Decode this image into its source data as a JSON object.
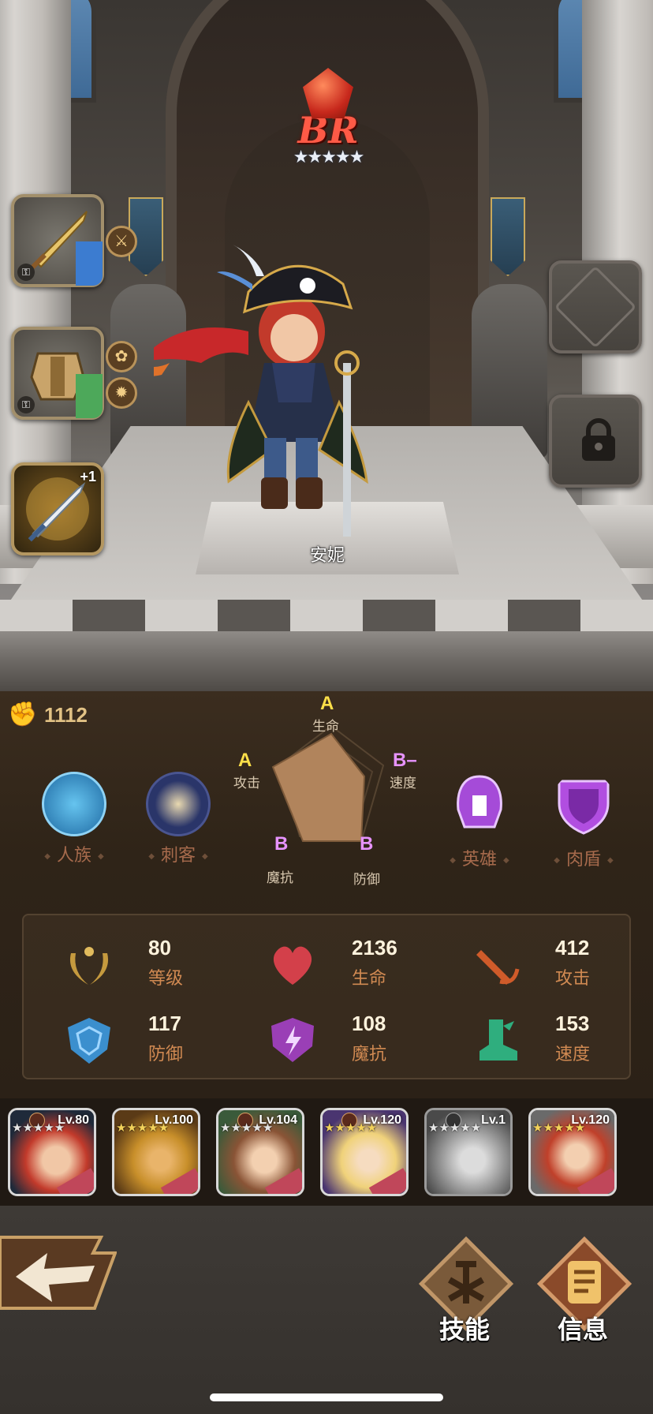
{
  "hero": {
    "name": "安妮",
    "rank": "BR",
    "stars": "★★★★★",
    "power": "1112"
  },
  "equipment": {
    "weapon_upgrade": "+1"
  },
  "attributes": [
    {
      "grade": "A",
      "label": "生命"
    },
    {
      "grade": "A",
      "label": "攻击"
    },
    {
      "grade": "B–",
      "label": "速度"
    },
    {
      "grade": "B",
      "label": "魔抗"
    },
    {
      "grade": "B",
      "label": "防御"
    }
  ],
  "tags": [
    {
      "label": "人族",
      "icon": "human-race-icon"
    },
    {
      "label": "刺客",
      "icon": "assassin-class-icon"
    },
    {
      "label": "英雄",
      "icon": "hero-helmet-icon"
    },
    {
      "label": "肉盾",
      "icon": "tank-shield-icon"
    }
  ],
  "stats": [
    {
      "value": "80",
      "label": "等级",
      "icon": "laurel-icon"
    },
    {
      "value": "2136",
      "label": "生命",
      "icon": "heart-icon"
    },
    {
      "value": "412",
      "label": "攻击",
      "icon": "sword-icon"
    },
    {
      "value": "117",
      "label": "防御",
      "icon": "defense-shield-icon"
    },
    {
      "value": "108",
      "label": "魔抗",
      "icon": "lightning-shield-icon"
    },
    {
      "value": "153",
      "label": "速度",
      "icon": "boot-icon"
    }
  ],
  "roster": [
    {
      "level": "Lv.80",
      "stars": "★★★★★",
      "selected": true
    },
    {
      "level": "Lv.100",
      "stars": "★★★★★"
    },
    {
      "level": "Lv.104",
      "stars": "★★★★★"
    },
    {
      "level": "Lv.120",
      "stars": "★★★★★"
    },
    {
      "level": "Lv.1",
      "stars": "★★★★★",
      "locked": true
    },
    {
      "level": "Lv.120",
      "stars": "★★★★★"
    }
  ],
  "nav": {
    "skills": "技能",
    "info": "信息"
  },
  "colors": {
    "grade_a": "#ffe049",
    "grade_b": "#e793ff",
    "stat_label": "#d18a52",
    "panel": "#2f2418"
  }
}
